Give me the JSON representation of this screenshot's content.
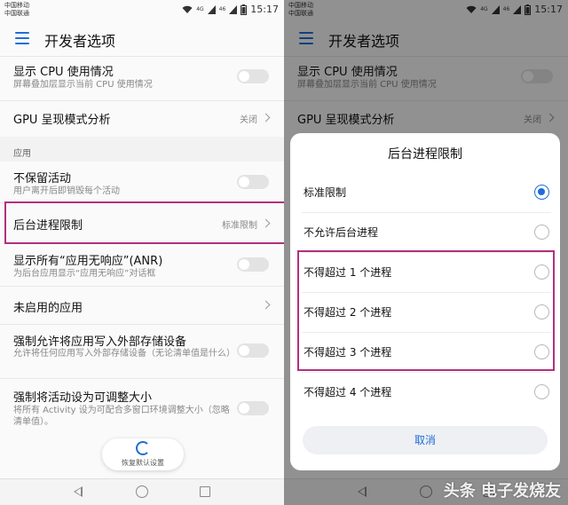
{
  "status": {
    "carrier_line1": "中国移动",
    "carrier_line2": "中国联通",
    "network_4g": "4G",
    "network_46": "46",
    "time": "15:17"
  },
  "appbar": {
    "title": "开发者选项",
    "menu_icon": "hamburger-menu-icon"
  },
  "settings": {
    "cpu_usage": {
      "title": "显示 CPU 使用情况",
      "subtitle": "屏幕叠加层显示当前 CPU 使用情况",
      "enabled": false
    },
    "gpu_mode": {
      "title": "GPU 呈现模式分析",
      "value": "关闭"
    },
    "section_apps": "应用",
    "dont_keep": {
      "title": "不保留活动",
      "subtitle": "用户离开后即销毁每个活动",
      "enabled": false
    },
    "bg_limit": {
      "title": "后台进程限制",
      "value": "标准限制"
    },
    "anr": {
      "title": "显示所有“应用无响应”(ANR)",
      "subtitle": "为后台应用显示“应用无响应”对话框",
      "enabled": false
    },
    "inactive_apps": {
      "title": "未启用的应用"
    },
    "force_external": {
      "title": "强制允许将应用写入外部存储设备",
      "subtitle": "允许将任何应用写入外部存储设备（无论清单值是什么）",
      "enabled": false
    },
    "force_resizable": {
      "title": "强制将活动设为可调整大小",
      "subtitle": "将所有 Activity 设为可配合多窗口环境调整大小（忽略清单值）。",
      "enabled": false
    },
    "restore_default": "恢复默认设置"
  },
  "dialog": {
    "title": "后台进程限制",
    "options": [
      {
        "label": "标准限制",
        "selected": true
      },
      {
        "label": "不允许后台进程",
        "selected": false
      },
      {
        "label": "不得超过 1 个进程",
        "selected": false
      },
      {
        "label": "不得超过 2 个进程",
        "selected": false
      },
      {
        "label": "不得超过 3 个进程",
        "selected": false
      },
      {
        "label": "不得超过 4 个进程",
        "selected": false
      }
    ],
    "cancel": "取消"
  },
  "navbar": {
    "back_icon": "back-triangle-icon",
    "home_icon": "home-circle-icon",
    "recent_icon": "recent-square-icon"
  },
  "watermark": "头条 电子发烧友",
  "colors": {
    "accent": "#1e6dd8",
    "highlight_frame": "#b2307e"
  }
}
